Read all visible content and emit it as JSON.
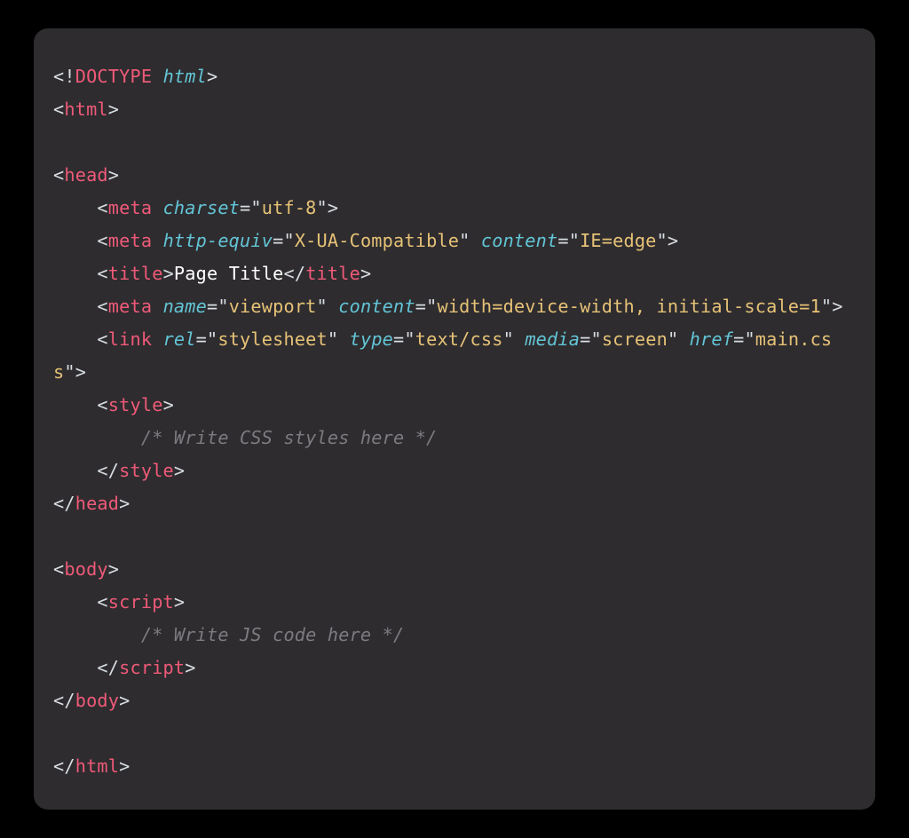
{
  "tokens": {
    "lt": "<",
    "gt": ">",
    "slash": "/",
    "excl": "!",
    "eq": "=",
    "q": "\"",
    "doctype": "DOCTYPE",
    "html": "html",
    "head": "head",
    "meta": "meta",
    "title": "title",
    "link": "link",
    "style": "style",
    "body": "body",
    "script": "script",
    "charset": "charset",
    "httpEquiv": "http-equiv",
    "content": "content",
    "name": "name",
    "rel": "rel",
    "type": "type",
    "media": "media",
    "href": "href",
    "utf8": "utf-8",
    "xua": "X-UA-Compatible",
    "ieedge": "IE=edge",
    "viewport": "viewport",
    "viewportContent": "width=device-width, initial-scale=1",
    "stylesheet": "stylesheet",
    "textcss": "text/css",
    "screen": "screen",
    "maincss": "main.css",
    "pageTitle": "Page Title",
    "cssComment": "/* Write CSS styles here */",
    "jsComment": "/* Write JS code here */",
    "indent1": "    ",
    "indent2": "        "
  }
}
